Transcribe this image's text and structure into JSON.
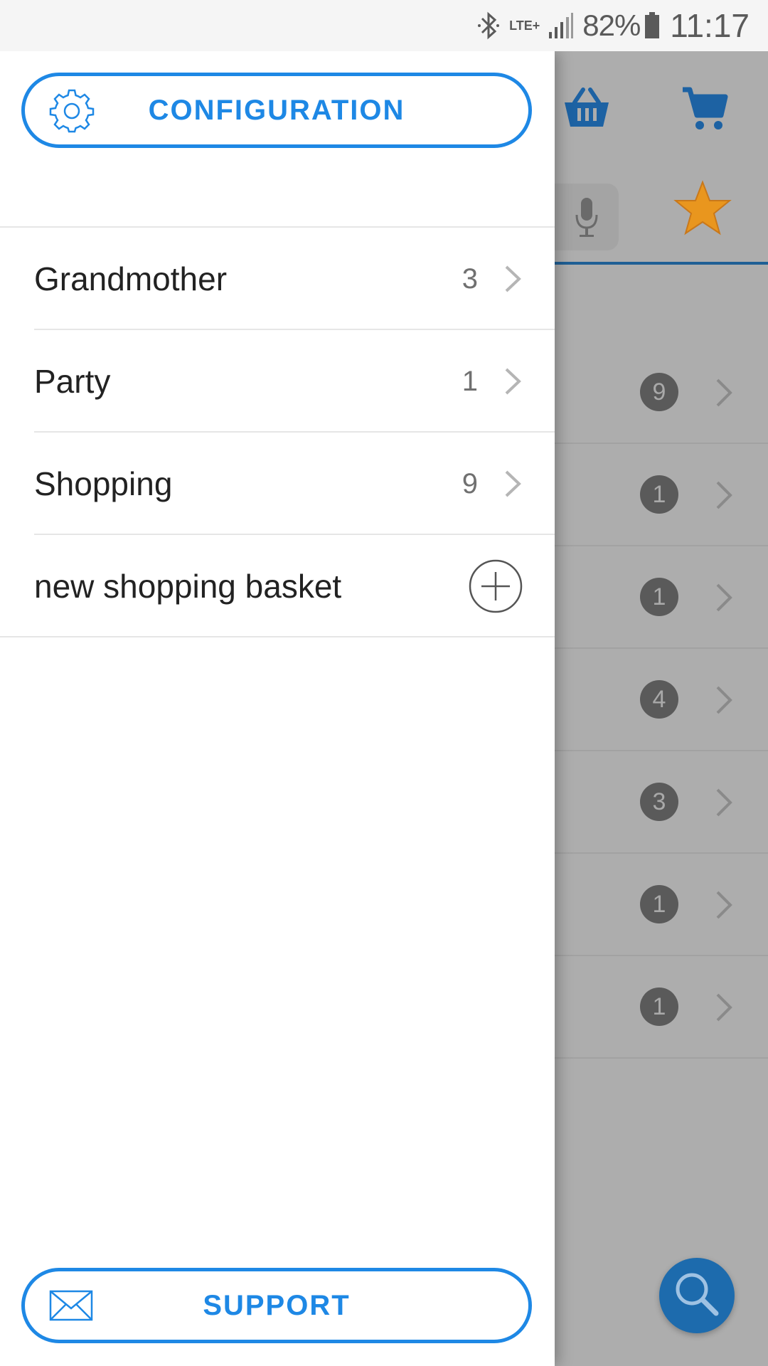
{
  "status_bar": {
    "network": "LTE+",
    "battery_percent": "82%",
    "time": "11:17",
    "icons": [
      "bluetooth-icon",
      "lte-icon",
      "signal-icon",
      "battery-icon"
    ]
  },
  "drawer": {
    "config_button": {
      "label": "CONFIGURATION",
      "icon": "gear-icon"
    },
    "lists": [
      {
        "label": "Grandmother",
        "count": "3"
      },
      {
        "label": "Party",
        "count": "1"
      },
      {
        "label": "Shopping",
        "count": "9"
      }
    ],
    "new_list": {
      "label": "new shopping basket",
      "icon": "plus-circle-icon"
    },
    "support_button": {
      "label": "SUPPORT",
      "icon": "envelope-icon"
    }
  },
  "background_app": {
    "toolbar_icons": [
      "basket-icon",
      "cart-icon",
      "mic-icon",
      "star-icon"
    ],
    "row_badges": [
      "9",
      "1",
      "1",
      "4",
      "3",
      "1",
      "1"
    ],
    "fab_icon": "search-icon"
  },
  "colors": {
    "accent": "#1e88e5",
    "dim_overlay": "#adadad",
    "badge": "#5a5a5a",
    "star": "#f0a020"
  }
}
